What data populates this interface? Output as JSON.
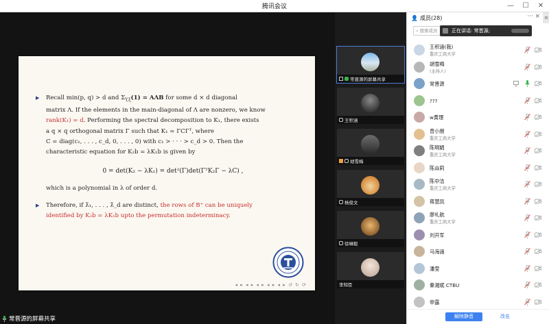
{
  "window": {
    "title": "腾讯会议"
  },
  "share": {
    "sharer_label": "常晋源的屏幕共享",
    "slide": {
      "p1_l1": "Recall min(p, q) > d and Σ",
      "p1_l1_sub": "Y,ξ",
      "p1_l1b": "(1) = AΛB",
      "p1_l1c": " for some d × d diagonal",
      "p1_l2": "matrix Λ. If the elements in the main-diagonal of Λ are nonzero, we know",
      "p1_l3_red": "rank(K₁) = d",
      "p1_l3": ". Performing the spectral decomposition to K₁, there exists",
      "p1_l4": "a q × q orthogonal matrix Γ such that K₁ = ΓCΓᵀ, where",
      "p1_l5": "C = diag(c₁, . . . , c_d, 0, . . . , 0) with c₁ > · · · > c_d > 0. Then the",
      "p1_l6": "characteristic equation for K₂b = λK₁b is given by",
      "equation": "0 = det(K₂ − λK₁) = det²(Γ)det(ΓᵀK₂Γ − λC) ,",
      "p1_l7": "which is a polynomial in λ of order d.",
      "p2_l1": "Therefore, if λ̃₁, . . . , λ̃_d are distinct, ",
      "p2_l1_red": "the rows of B⁺ can be uniquely",
      "p2_l2_red": "identified by K₂b = λK₁b upto the permutation indeterminacy."
    }
  },
  "videos": [
    {
      "label": "常晋源的屏幕共享"
    },
    {
      "label": "王积涵"
    },
    {
      "label": "胡雪梅"
    },
    {
      "label": "杨俊文"
    },
    {
      "label": "徐琳毅"
    },
    {
      "label": "李知臣"
    }
  ],
  "panel": {
    "title": "成员(28)",
    "more": "···",
    "close": "×",
    "search_placeholder": "搜索成员",
    "speaking": "正在讲话: 常晋源;",
    "members": [
      {
        "name": "王积涵(我)",
        "sub": "重庆工商大学"
      },
      {
        "name": "胡雪梅",
        "sub": "(主持人)"
      },
      {
        "name": "常晋源",
        "sub": ""
      },
      {
        "name": "???",
        "sub": ""
      },
      {
        "name": "w黄理",
        "sub": ""
      },
      {
        "name": "曾小朋",
        "sub": "重庆工商大学"
      },
      {
        "name": "陈明娟",
        "sub": "重庆工商大学"
      },
      {
        "name": "陈焱莉",
        "sub": ""
      },
      {
        "name": "陈中洁",
        "sub": "重庆工商大学"
      },
      {
        "name": "蒋慧凤",
        "sub": ""
      },
      {
        "name": "廖礼航",
        "sub": "重庆工商大学"
      },
      {
        "name": "刘开军",
        "sub": ""
      },
      {
        "name": "马海涵",
        "sub": ""
      },
      {
        "name": "潘莹",
        "sub": ""
      },
      {
        "name": "秦湘斌 CTBU",
        "sub": ""
      },
      {
        "name": "申露",
        "sub": ""
      }
    ],
    "unmute_all": "解除静音",
    "rename": "改名"
  },
  "colors": {
    "accent": "#3d82f0",
    "slide_red": "#c62d2d",
    "mic_off": "#d9534f",
    "mic_on": "#3bb54a"
  }
}
